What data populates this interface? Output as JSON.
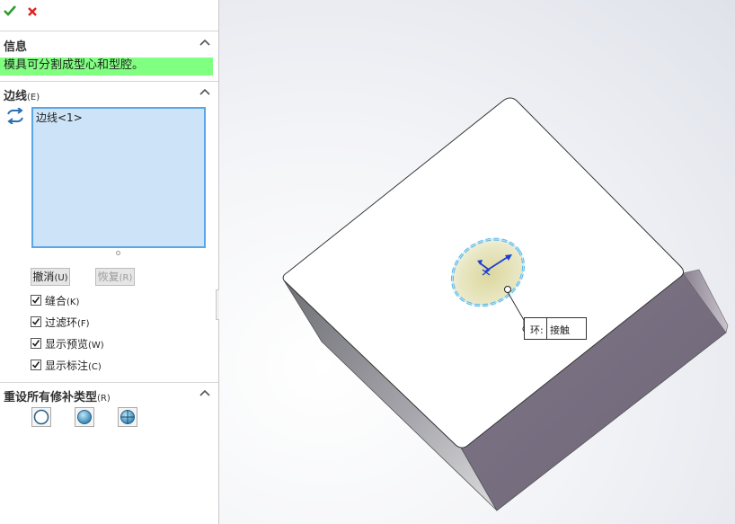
{
  "toolbar": {
    "ok_icon": "checkmark-icon",
    "cancel_icon": "x-icon"
  },
  "info": {
    "title": "信息",
    "message": "模具可分割成型心和型腔。"
  },
  "edges": {
    "title": "边线",
    "title_key": "(E)",
    "items": [
      "边线<1>"
    ],
    "undo_label": "撤消",
    "undo_key": "(U)",
    "restore_label": "恢复",
    "restore_key": "(R)"
  },
  "options": [
    {
      "label": "缝合",
      "key": "(K)",
      "checked": true
    },
    {
      "label": "过滤环",
      "key": "(F)",
      "checked": true
    },
    {
      "label": "显示预览",
      "key": "(W)",
      "checked": true
    },
    {
      "label": "显示标注",
      "key": "(C)",
      "checked": true
    }
  ],
  "patch": {
    "title": "重设所有修补类型",
    "title_key": "(R)",
    "types": [
      "no-fill-icon",
      "contact-fill-icon",
      "tangent-fill-icon"
    ]
  },
  "callout": {
    "label": "环:",
    "value": "接触"
  },
  "colors": {
    "info_bg": "#80ff80",
    "list_bg": "#cde3f7",
    "list_border": "#5aa7e8",
    "selection": "#5ab8e8"
  }
}
